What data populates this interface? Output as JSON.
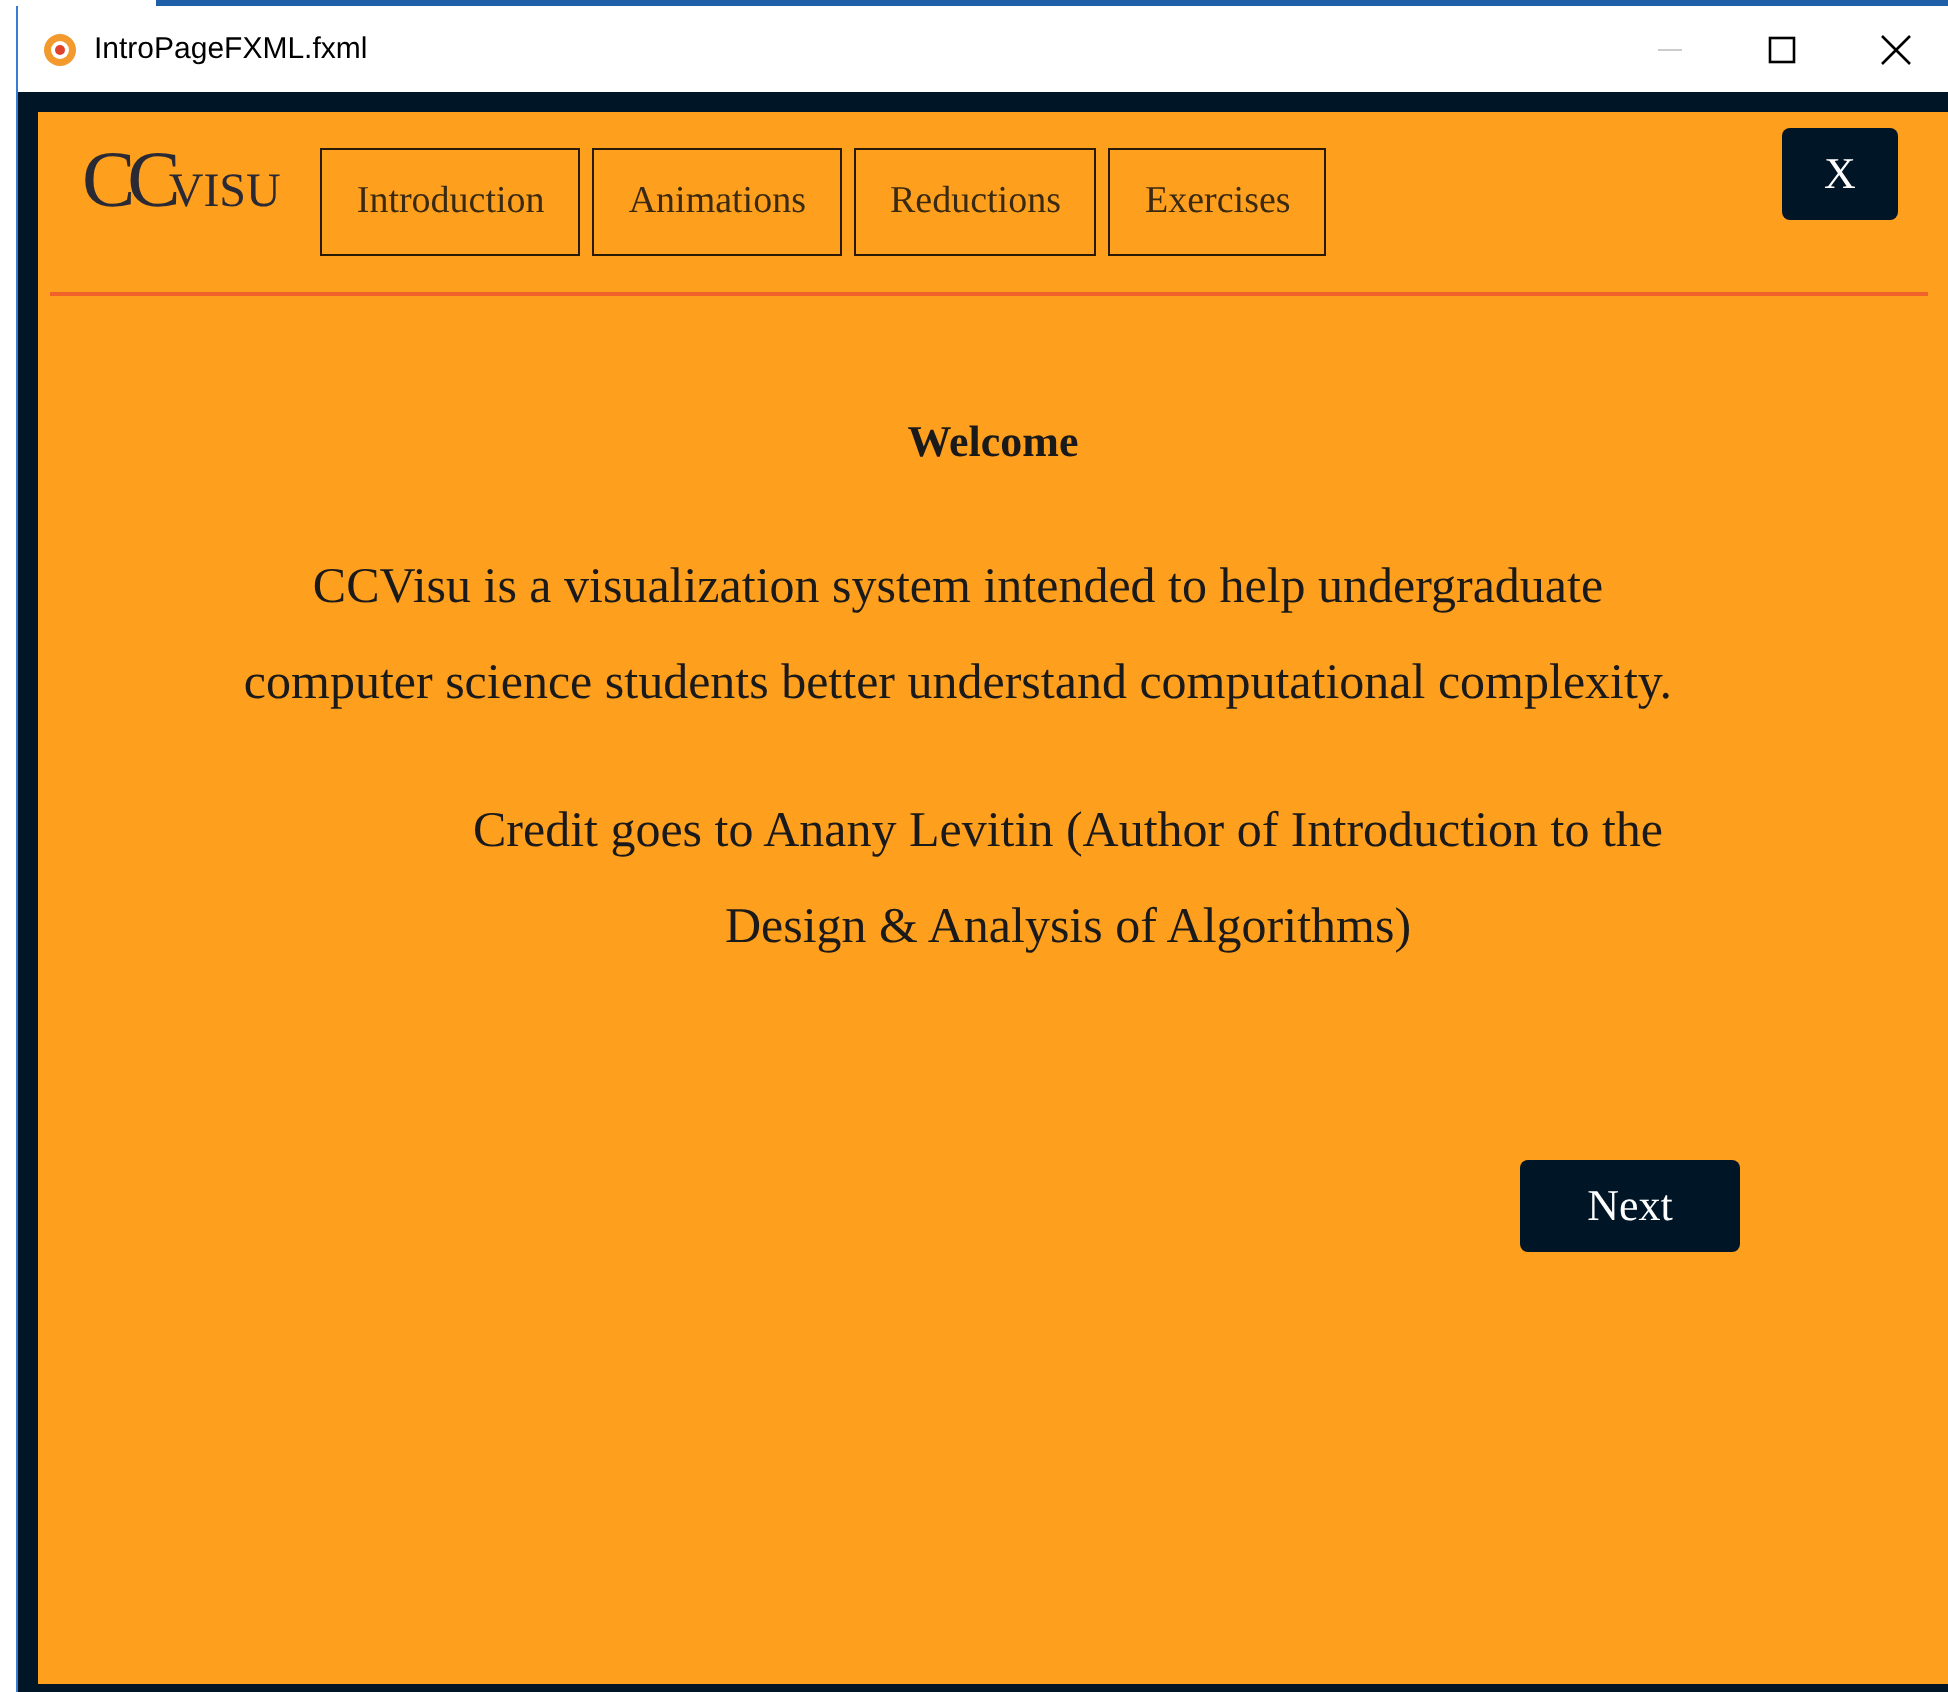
{
  "window": {
    "title": "IntroPageFXML.fxml"
  },
  "logo": {
    "initials": "CC",
    "name": "VISU"
  },
  "nav": [
    "Introduction",
    "Animations",
    "Reductions",
    "Exercises"
  ],
  "close_label": "X",
  "heading": "Welcome",
  "paragraphs": [
    "CCVisu is a visualization system intended to help undergraduate computer science students better understand computational complexity.",
    "Credit goes to Anany Levitin (Author of Introduction to the Design & Analysis of Algorithms)"
  ],
  "next_label": "Next"
}
